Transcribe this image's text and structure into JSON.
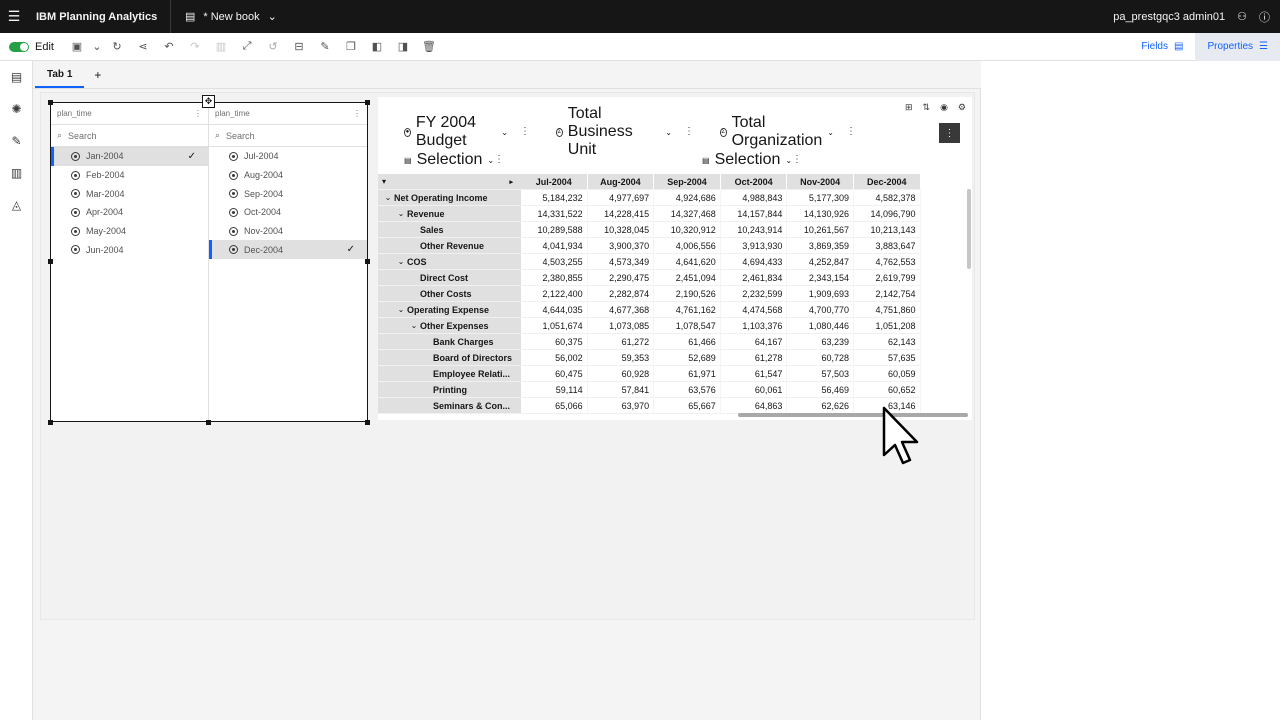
{
  "app": {
    "title": "IBM Planning Analytics",
    "book_name": "* New book",
    "user": "pa_prestgqc3 admin01"
  },
  "toolbar": {
    "edit_label": "Edit",
    "fields_label": "Fields",
    "properties_label": "Properties"
  },
  "tabs": {
    "tab1": "Tab 1",
    "add": "+"
  },
  "selector": {
    "col1": {
      "header": "plan_time",
      "search_placeholder": "Search",
      "items": [
        "Jan-2004",
        "Feb-2004",
        "Mar-2004",
        "Apr-2004",
        "May-2004",
        "Jun-2004"
      ],
      "selected": "Jan-2004"
    },
    "col2": {
      "header": "plan_time",
      "search_placeholder": "Search",
      "items": [
        "Jul-2004",
        "Aug-2004",
        "Sep-2004",
        "Oct-2004",
        "Nov-2004",
        "Dec-2004"
      ],
      "selected": "Dec-2004"
    }
  },
  "cube": {
    "context": {
      "version": "FY 2004 Budget",
      "business_unit": "Total Business Unit",
      "organization": "Total Organization"
    },
    "rows_sel": "Selection",
    "cols_sel": "Selection",
    "columns": [
      "Jul-2004",
      "Aug-2004",
      "Sep-2004",
      "Oct-2004",
      "Nov-2004",
      "Dec-2004"
    ],
    "rows": [
      {
        "label": "Net Operating Income",
        "values": [
          "5,184,232",
          "4,977,697",
          "4,924,686",
          "4,988,843",
          "5,177,309",
          "4,582,378"
        ]
      },
      {
        "label": "Revenue",
        "values": [
          "14,331,522",
          "14,228,415",
          "14,327,468",
          "14,157,844",
          "14,130,926",
          "14,096,790"
        ]
      },
      {
        "label": "Sales",
        "values": [
          "10,289,588",
          "10,328,045",
          "10,320,912",
          "10,243,914",
          "10,261,567",
          "10,213,143"
        ]
      },
      {
        "label": "Other Revenue",
        "values": [
          "4,041,934",
          "3,900,370",
          "4,006,556",
          "3,913,930",
          "3,869,359",
          "3,883,647"
        ]
      },
      {
        "label": "COS",
        "values": [
          "4,503,255",
          "4,573,349",
          "4,641,620",
          "4,694,433",
          "4,252,847",
          "4,762,553"
        ]
      },
      {
        "label": "Direct Cost",
        "values": [
          "2,380,855",
          "2,290,475",
          "2,451,094",
          "2,461,834",
          "2,343,154",
          "2,619,799"
        ]
      },
      {
        "label": "Other Costs",
        "values": [
          "2,122,400",
          "2,282,874",
          "2,190,526",
          "2,232,599",
          "1,909,693",
          "2,142,754"
        ]
      },
      {
        "label": "Operating Expense",
        "values": [
          "4,644,035",
          "4,677,368",
          "4,761,162",
          "4,474,568",
          "4,700,770",
          "4,751,860"
        ]
      },
      {
        "label": "Other Expenses",
        "values": [
          "1,051,674",
          "1,073,085",
          "1,078,547",
          "1,103,376",
          "1,080,446",
          "1,051,208"
        ]
      },
      {
        "label": "Bank Charges",
        "values": [
          "60,375",
          "61,272",
          "61,466",
          "64,167",
          "63,239",
          "62,143"
        ]
      },
      {
        "label": "Board of Directors",
        "values": [
          "56,002",
          "59,353",
          "52,689",
          "61,278",
          "60,728",
          "57,635"
        ]
      },
      {
        "label": "Employee Relati...",
        "values": [
          "60,475",
          "60,928",
          "61,971",
          "61,547",
          "57,503",
          "60,059"
        ]
      },
      {
        "label": "Printing",
        "values": [
          "59,114",
          "57,841",
          "63,576",
          "60,061",
          "56,469",
          "60,652"
        ]
      },
      {
        "label": "Seminars & Con...",
        "values": [
          "65,066",
          "63,970",
          "65,667",
          "64,863",
          "62,626",
          "63,146"
        ]
      }
    ]
  }
}
